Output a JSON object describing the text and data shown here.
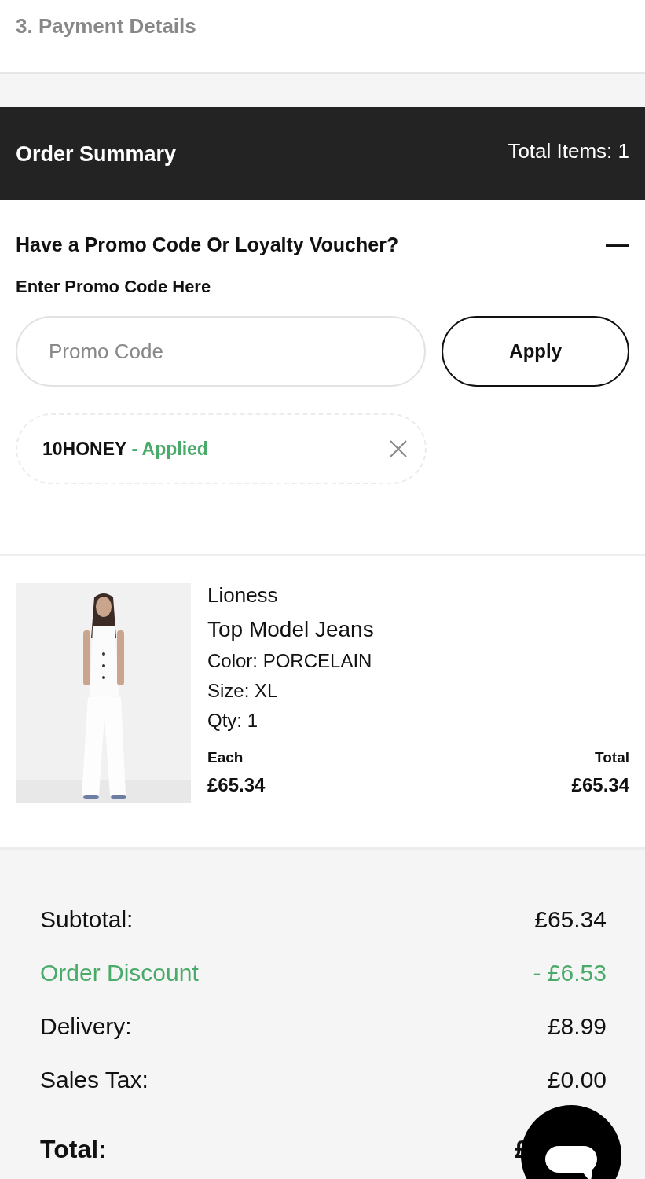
{
  "step_header": {
    "title": "3. Payment Details"
  },
  "order_summary": {
    "title": "Order Summary",
    "total_items": "Total Items: 1"
  },
  "promo": {
    "question": "Have a Promo Code Or Loyalty Voucher?",
    "expanded": true,
    "collapse_icon": "—",
    "field_label": "Enter Promo Code Here",
    "placeholder": "Promo Code",
    "apply_button": "Apply",
    "applied_codes": [
      {
        "code": "10HONEY",
        "status": "- Applied"
      }
    ]
  },
  "items": [
    {
      "kind": "picture",
      "brand": "Lioness",
      "name": "Top Model Jeans",
      "details": [
        "Color: PORCELAIN",
        "Size: XL",
        "Qty: 1"
      ],
      "each_label": "Each",
      "each_price": "£65.34",
      "total_label": "Total",
      "total_price": "£65.34"
    }
  ],
  "totals": [
    {
      "kind": "normal",
      "label": "Subtotal:",
      "value": "£65.34"
    },
    {
      "kind": "discount",
      "label": "Order Discount",
      "value": "- £6.53"
    },
    {
      "kind": "normal",
      "label": "Delivery:",
      "value": "£8.99"
    },
    {
      "kind": "normal",
      "label": "Sales Tax:",
      "value": "£0.00"
    },
    {
      "kind": "grand",
      "label": "Total:",
      "value": "£"
    }
  ]
}
